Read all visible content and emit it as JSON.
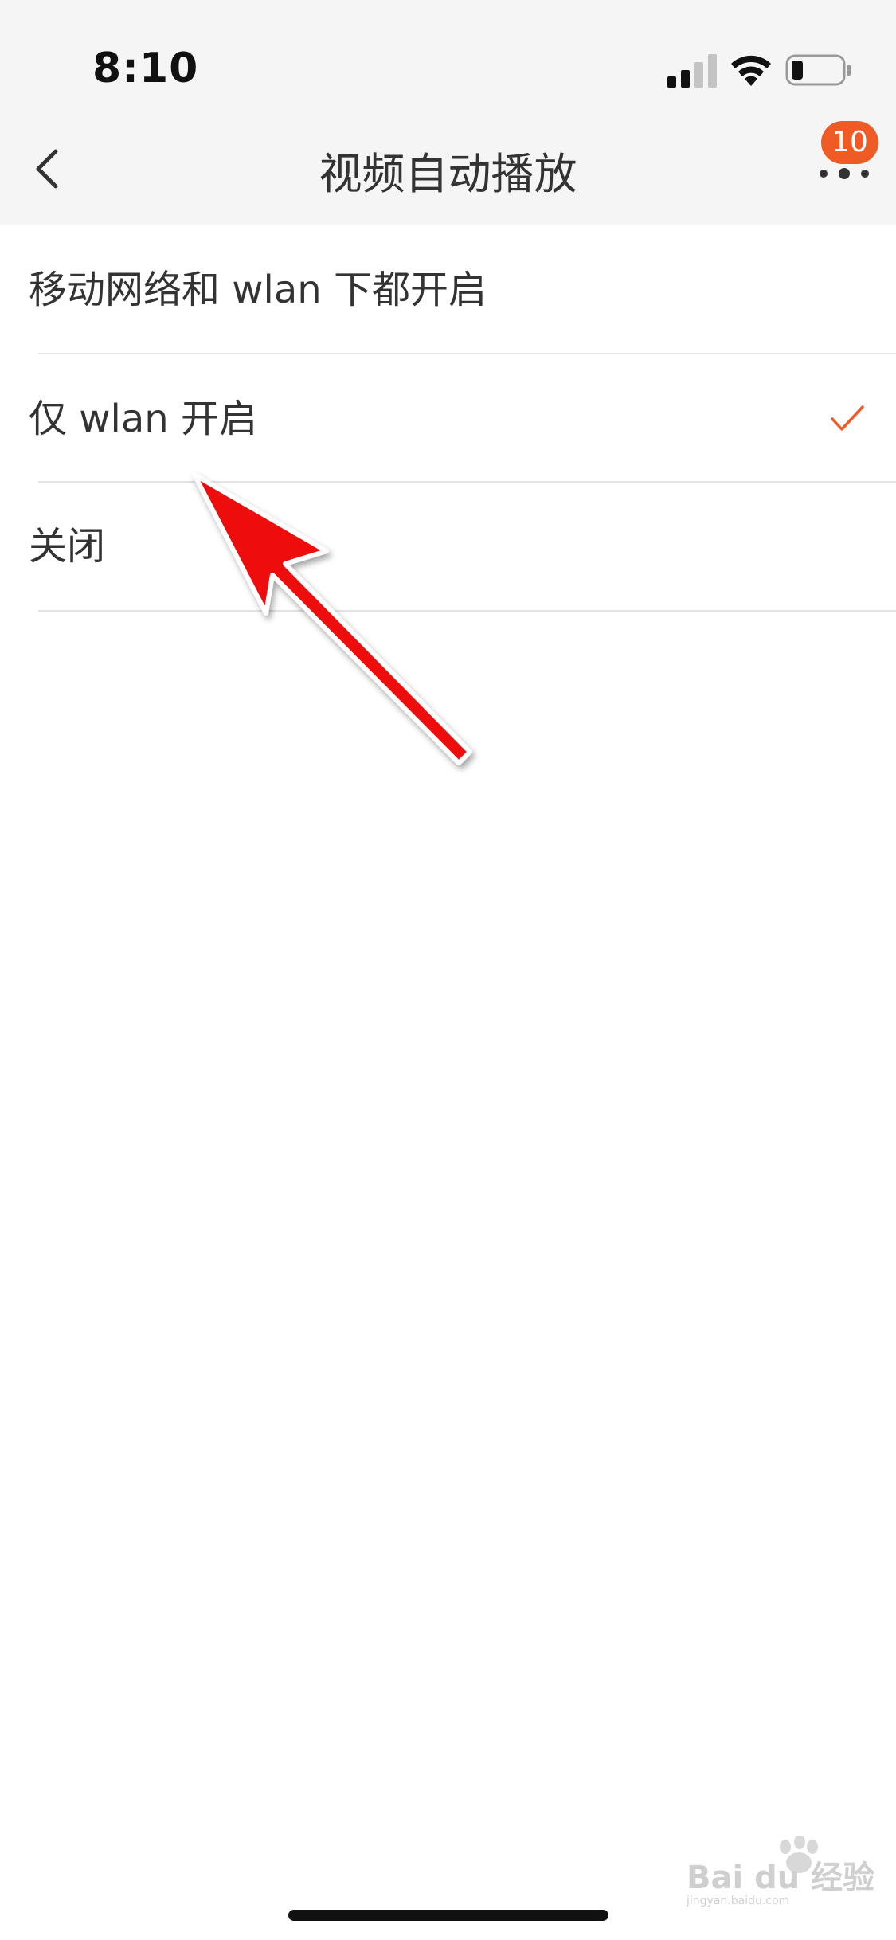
{
  "status_bar": {
    "time": "8:10"
  },
  "nav": {
    "title": "视频自动播放",
    "badge_count": "10"
  },
  "options": [
    {
      "label": "移动网络和 wlan 下都开启",
      "selected": false
    },
    {
      "label": "仅 wlan 开启",
      "selected": true
    },
    {
      "label": "关闭",
      "selected": false
    }
  ],
  "watermark": {
    "text": "Bai du 经验",
    "subtext": "jingyan.baidu.com"
  },
  "colors": {
    "accent": "#ef5a25",
    "arrow": "#ee1111",
    "header_bg": "#f5f5f5"
  }
}
